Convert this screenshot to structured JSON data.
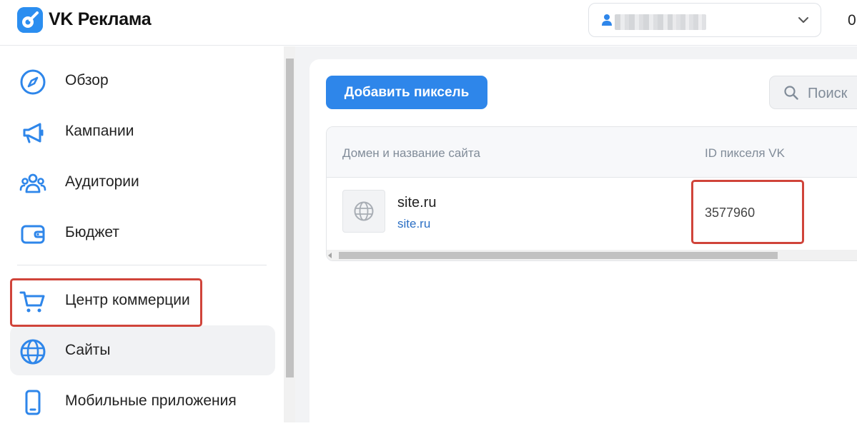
{
  "header": {
    "app_title": "VK Реклама",
    "logo_icon": "vk-ads-logo-icon",
    "account_icon": "person-icon",
    "account_chevron_icon": "chevron-down-icon",
    "right_text": "0"
  },
  "sidebar": {
    "items": [
      {
        "label": "Обзор",
        "icon": "compass-icon"
      },
      {
        "label": "Кампании",
        "icon": "megaphone-icon"
      },
      {
        "label": "Аудитории",
        "icon": "audience-icon"
      },
      {
        "label": "Бюджет",
        "icon": "wallet-icon"
      },
      {
        "label": "Центр коммерции",
        "icon": "cart-icon"
      },
      {
        "label": "Сайты",
        "icon": "globe-icon",
        "active": true
      },
      {
        "label": "Мобильные приложения",
        "icon": "smartphone-icon"
      }
    ]
  },
  "main": {
    "add_pixel_label": "Добавить пиксель",
    "search": {
      "placeholder": "Поиск",
      "icon": "search-icon"
    },
    "table": {
      "columns": [
        "Домен и название сайта",
        "ID пикселя VK"
      ],
      "rows": [
        {
          "site_name": "site.ru",
          "site_link": "site.ru",
          "pixel_id": "3577960",
          "thumb_icon": "globe-icon"
        }
      ]
    }
  },
  "colors": {
    "accent": "#2e86ea",
    "highlight": "#d0443a",
    "link": "#2b6fc4"
  }
}
